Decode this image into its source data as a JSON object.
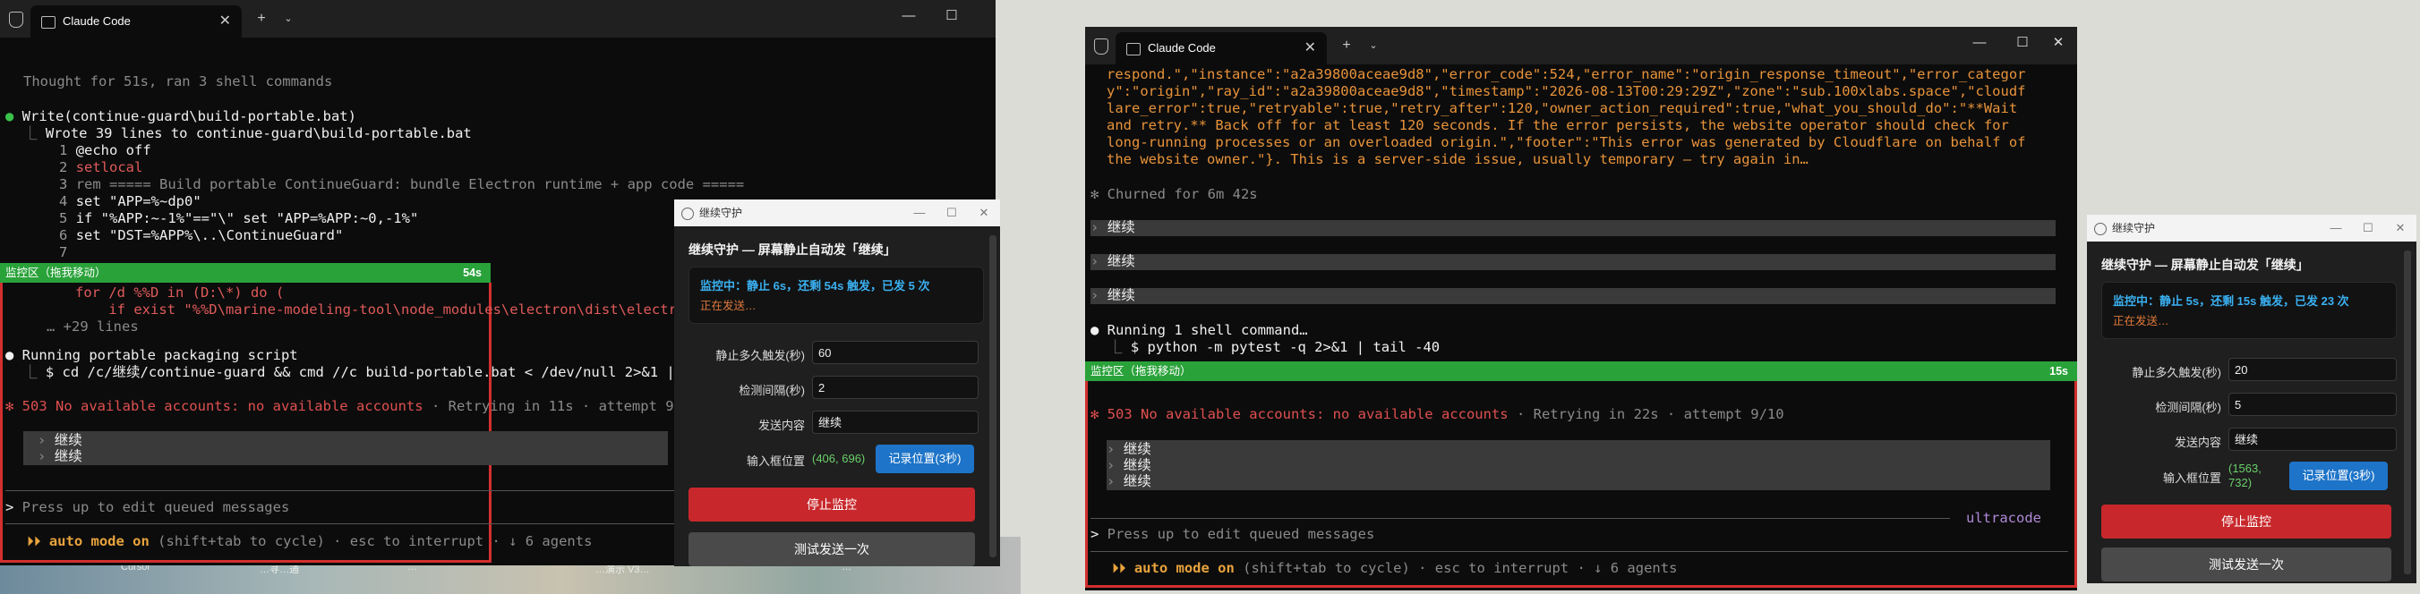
{
  "left_terminal": {
    "tab_title": "Claude Code",
    "thought": "Thought for 51s, ran 3 shell commands",
    "write_call": "Write(continue-guard\\build-portable.bat)",
    "write_result": "Wrote 39 lines to continue-guard\\build-portable.bat",
    "code_lines": [
      {
        "n": "1",
        "t": "@echo off"
      },
      {
        "n": "2",
        "t": "setlocal"
      },
      {
        "n": "3",
        "t": "rem ===== Build portable ContinueGuard: bundle Electron runtime + app code ====="
      },
      {
        "n": "4",
        "t": "set \"APP=%~dp0\""
      },
      {
        "n": "5",
        "t": "if \"%APP:~-1%\"==\"\\\" set \"APP=%APP:~0,-1%\""
      },
      {
        "n": "6",
        "t": "set \"DST=%APP%\\..\\ContinueGuard\""
      },
      {
        "n": "7",
        "t": ""
      },
      {
        "n": "",
        "t": "for /d %%D in (D:\\*) do ("
      },
      {
        "n": "",
        "t": "    if exist \"%%D\\marine-modeling-tool\\node_modules\\electron\\dist\\electron"
      }
    ],
    "more_lines": "… +29 lines",
    "running": "Running portable packaging script",
    "running_cmd": "$ cd /c/继续/continue-guard && cmd //c build-portable.bat < /dev/null 2>&1 | t",
    "error": "503 No available accounts: no available accounts",
    "retry": "· Retrying in 11s · attempt 9/10",
    "queued": [
      "继续",
      "继续"
    ],
    "prompt_placeholder": "Press up to edit queued messages",
    "footer_mode": "auto mode on",
    "footer_rest": "(shift+tab to cycle) · esc to interrupt · ↓ 6 agents",
    "monitor_label": "监控区（拖我移动）",
    "monitor_time": "54s"
  },
  "right_terminal": {
    "tab_title": "Claude Code",
    "json_lines": [
      "respond.\",\"instance\":\"a2a39800aceae9d8\",\"error_code\":524,\"error_name\":\"origin_response_timeout\",\"error_categor",
      "y\":\"origin\",\"ray_id\":\"a2a39800aceae9d8\",\"timestamp\":\"2026-08-13T00:29:29Z\",\"zone\":\"sub.100xlabs.space\",\"cloudf",
      "lare_error\":true,\"retryable\":true,\"retry_after\":120,\"owner_action_required\":true,\"what_you_should_do\":\"**Wait",
      "and retry.** Back off for at least 120 seconds. If the error persists, the website operator should check for",
      "long-running processes or an overloaded origin.\",\"footer\":\"This error was generated by Cloudflare on behalf of",
      "the website owner.\"}. This is a server-side issue, usually temporary — try again in…"
    ],
    "churned": "Churned for 6m 42s",
    "continue_items": [
      "继续",
      "继续",
      "继续"
    ],
    "running": "Running 1 shell command…",
    "running_cmd": "$ python -m pytest -q 2>&1 | tail -40",
    "error": "503 No available accounts: no available accounts",
    "retry": "· Retrying in 22s · attempt 9/10",
    "queued": [
      "继续",
      "继续",
      "继续"
    ],
    "ultracode": "ultracode",
    "prompt_placeholder": "Press up to edit queued messages",
    "footer_mode": "auto mode on",
    "footer_rest": "(shift+tab to cycle) · esc to interrupt · ↓ 6 agents",
    "monitor_label": "监控区（拖我移动）",
    "monitor_time": "15s"
  },
  "guard_left": {
    "window_title": "继续守护",
    "heading": "继续守护 — 屏幕静止自动发「继续」",
    "status_main": "监控中：静止 6s，还剩 54s 触发，已发 5 次",
    "status_sub": "正在发送…",
    "idle_label": "静止多久触发(秒)",
    "idle_value": "60",
    "interval_label": "检测间隔(秒)",
    "interval_value": "2",
    "send_label": "发送内容",
    "send_value": "继续",
    "pos_label": "输入框位置",
    "pos_value": "(406, 696)",
    "record_btn": "记录位置(3秒)",
    "stop_btn": "停止监控",
    "test_btn": "测试发送一次"
  },
  "guard_right": {
    "window_title": "继续守护",
    "heading": "继续守护 — 屏幕静止自动发「继续」",
    "status_main": "监控中：静止 5s，还剩 15s 触发，已发 23 次",
    "status_sub": "正在发送…",
    "idle_label": "静止多久触发(秒)",
    "idle_value": "20",
    "interval_label": "检测间隔(秒)",
    "interval_value": "5",
    "send_label": "发送内容",
    "send_value": "继续",
    "pos_label": "输入框位置",
    "pos_value_1": "(1563,",
    "pos_value_2": "732)",
    "record_btn": "记录位置(3秒)",
    "stop_btn": "停止监控",
    "test_btn": "测试发送一次"
  },
  "desktop": {
    "labels": [
      "Cursor",
      "…寻…通",
      "…",
      "…演示 V3…",
      "…"
    ]
  }
}
